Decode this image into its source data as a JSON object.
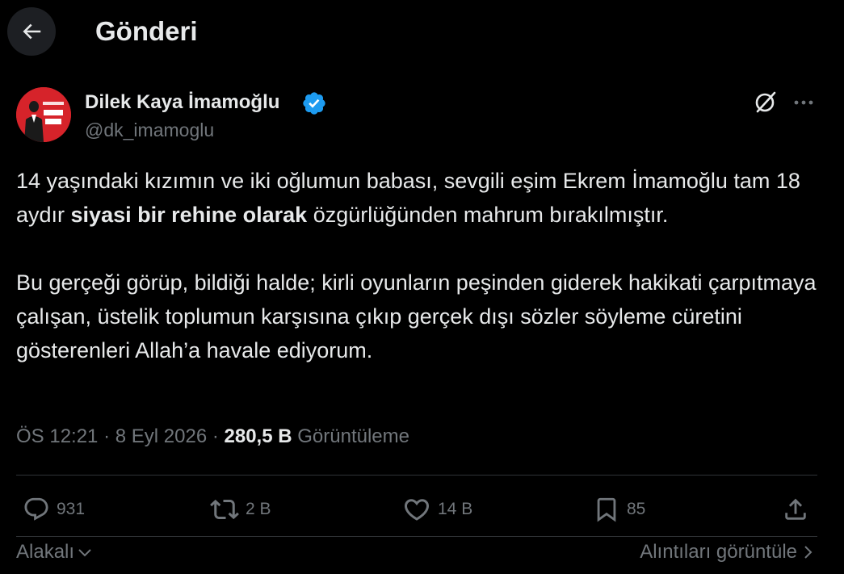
{
  "header": {
    "back_icon": "arrow-left-icon",
    "title": "Gönderi"
  },
  "author": {
    "name": "Dilek Kaya İmamoğlu",
    "handle": "@dk_imamoglu",
    "verified_icon": "verified-badge-icon",
    "verified_color": "#1d9bf0",
    "avatar_color": "#d6232a"
  },
  "post": {
    "p1_part1": "14 yaşındaki kızımın ve iki oğlumun babası, sevgili eşim Ekrem İmamoğlu tam 18 aydır ",
    "p1_bold": "siyasi bir rehine olarak",
    "p1_part2": " özgürlüğünden mahrum bırakılmıştır.",
    "p2": "Bu gerçeği görüp, bildiği halde; kirli oyunların peşinden giderek hakikati çarpıtmaya çalışan, üstelik toplumun karşısına çıkıp gerçek dışı sözler söyleme cüretini gösterenleri Allah’a havale ediyorum."
  },
  "meta": {
    "time": "ÖS 12:21",
    "sep": "·",
    "date": "8 Eyl 2026",
    "views_count": "280,5 B",
    "views_label": "Görüntüleme"
  },
  "actions": {
    "reply_count": "931",
    "repost_count": "2 B",
    "like_count": "14 B",
    "bookmark_count": "85"
  },
  "footer": {
    "sort_label": "Alakalı",
    "quotes_label": "Alıntıları görüntüle"
  }
}
